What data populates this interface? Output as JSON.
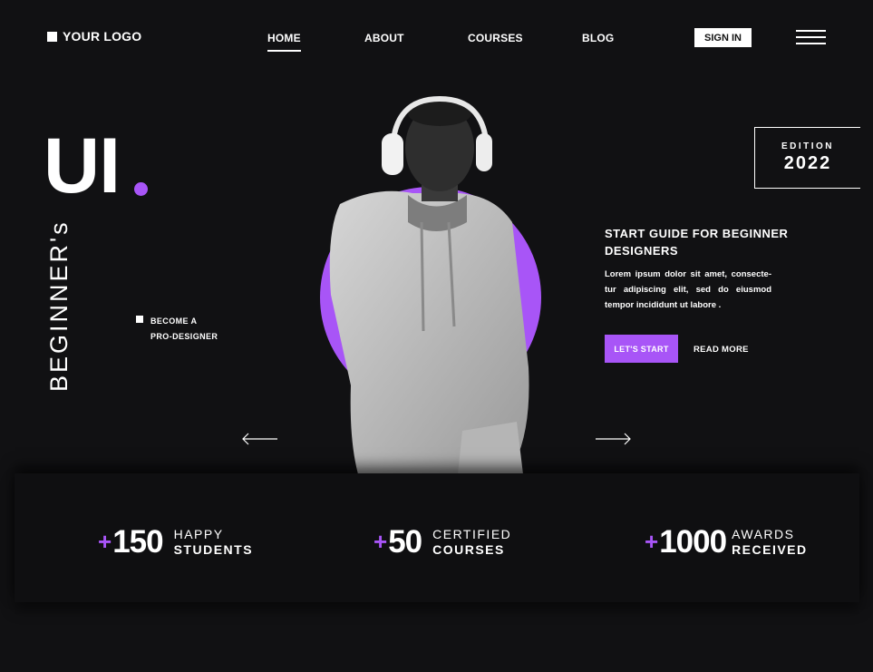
{
  "header": {
    "logo_text": "YOUR LOGO",
    "nav": [
      "HOME",
      "ABOUT",
      "COURSES",
      "BLOG"
    ],
    "active_nav": "HOME",
    "signin_label": "SIGN IN"
  },
  "hero": {
    "title": "UI",
    "vertical_text": "BEGINNER's",
    "become_line1": "BECOME A",
    "become_line2": "PRO-DESIGNER",
    "edition_label": "EDITION",
    "edition_year": "2022",
    "guide_title_line1": "START GUIDE FOR BEGINNER",
    "guide_title_line2": "DESIGNERS",
    "guide_body": "Lorem ipsum dolor sit amet, consecte-tur adipiscing elit, sed do eiusmod tempor incididunt ut labore .",
    "start_label": "LET'S START",
    "readmore_label": "READ MORE"
  },
  "stats": [
    {
      "plus": "+",
      "number": "150",
      "line1": "HAPPY",
      "line2": "STUDENTS"
    },
    {
      "plus": "+",
      "number": "50",
      "line1": "CERTIFIED",
      "line2": "COURSES"
    },
    {
      "plus": "+",
      "number": "1000",
      "line1": "AWARDS",
      "line2": "RECEIVED"
    }
  ],
  "colors": {
    "background": "#111113",
    "accent": "#a855f7",
    "text": "#ffffff"
  },
  "icons": [
    "arrow-left-icon",
    "arrow-right-icon",
    "hamburger-menu-icon"
  ]
}
